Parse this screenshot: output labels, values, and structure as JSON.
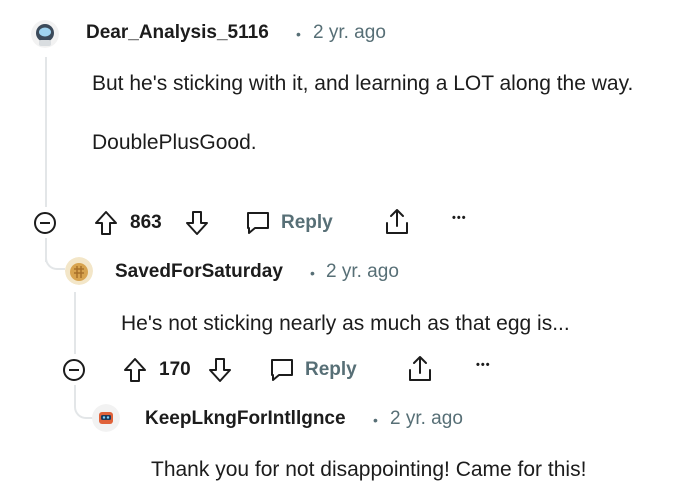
{
  "comments": [
    {
      "username": "Dear_Analysis_5116",
      "separator": "•",
      "time": "2 yr. ago",
      "body": [
        "But he's sticking with it, and learning a LOT along the way.",
        "DoublePlusGood."
      ],
      "votes": "863",
      "reply_label": "Reply",
      "more_label": "•••"
    },
    {
      "username": "SavedForSaturday",
      "separator": "•",
      "time": "2 yr. ago",
      "body": [
        "He's not sticking nearly as much as that egg is..."
      ],
      "votes": "170",
      "reply_label": "Reply",
      "more_label": "•••"
    },
    {
      "username": "KeepLkngForIntllgnce",
      "separator": "•",
      "time": "2 yr. ago",
      "body": [
        "Thank you for not disappointing! Came for this!"
      ]
    }
  ],
  "colors": {
    "text": "#1c1c1c",
    "meta": "#576f76",
    "thread": "#e3e6e8"
  }
}
